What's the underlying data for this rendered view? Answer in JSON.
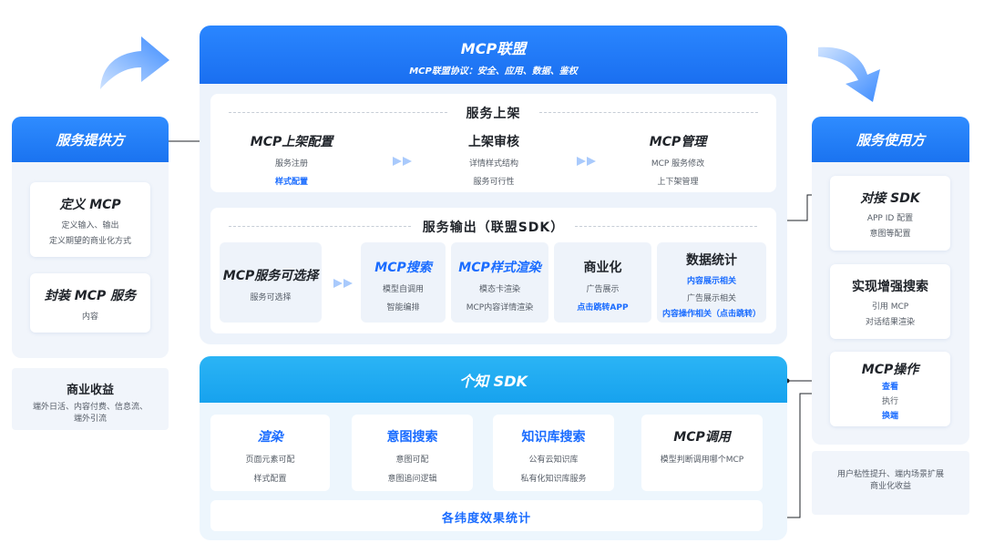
{
  "colors": {
    "primary": "#1a73f0",
    "cyan": "#17a2ee",
    "panel_bg": "#edf3fb",
    "text_blue": "#1a6cff"
  },
  "provider": {
    "title": "服务提供方",
    "cards": [
      {
        "title": "定义 MCP",
        "lines": [
          "定义输入、输出",
          "定义期望的商业化方式"
        ]
      },
      {
        "title": "封装 MCP 服务",
        "lines": [
          "内容"
        ]
      }
    ],
    "revenue": {
      "title": "商业收益",
      "lines": [
        "端外日活、内容付费、信息流、",
        "端外引流"
      ]
    }
  },
  "alliance": {
    "title": "MCP联盟",
    "subtitle": "MCP联盟协议：安全、应用、数据、鉴权",
    "listing": {
      "title": "服务上架",
      "steps": [
        {
          "title": "MCP上架配置",
          "lines": [
            "服务注册",
            "样式配置"
          ]
        },
        {
          "title": "上架审核",
          "lines": [
            "详情样式结构",
            "服务可行性"
          ]
        },
        {
          "title": "MCP管理",
          "lines": [
            "MCP 服务修改",
            "上下架管理"
          ]
        }
      ]
    },
    "output": {
      "title": "服务输出（联盟SDK）",
      "cards": [
        {
          "title": "MCP服务可选择",
          "lines": [
            "服务可选择"
          ]
        },
        {
          "title": "MCP搜索",
          "lines": [
            "模型自调用",
            "智能编排"
          ]
        },
        {
          "title": "MCP样式渲染",
          "lines": [
            "模态卡渲染",
            "MCP内容详情渲染"
          ]
        },
        {
          "title": "商业化",
          "lines": [
            "广告展示",
            "点击跳转APP"
          ]
        },
        {
          "title": "数据统计",
          "lines": [
            "内容展示相关",
            "广告展示相关",
            "内容操作相关（点击跳转）"
          ]
        }
      ]
    }
  },
  "gezhi": {
    "title": "个知 SDK",
    "cards": [
      {
        "title": "渲染",
        "lines": [
          "页面元素可配",
          "样式配置"
        ]
      },
      {
        "title": "意图搜索",
        "lines": [
          "意图可配",
          "意图追问逻辑"
        ]
      },
      {
        "title": "知识库搜索",
        "lines": [
          "公有云知识库",
          "私有化知识库服务"
        ]
      },
      {
        "title": "MCP调用",
        "lines": [
          "模型判断调用哪个MCP"
        ]
      }
    ],
    "stats": "各纬度效果统计"
  },
  "user": {
    "title": "服务使用方",
    "cards": [
      {
        "title": "对接 SDK",
        "lines": [
          "APP ID 配置",
          "意图等配置"
        ]
      },
      {
        "title": "实现增强搜索",
        "lines": [
          "引用 MCP",
          "对话结果渲染"
        ]
      },
      {
        "title": "MCP操作",
        "lines": [
          "查看",
          "执行",
          "换端"
        ]
      }
    ],
    "note": [
      "用户粘性提升、端内场景扩展",
      "商业化收益"
    ]
  }
}
